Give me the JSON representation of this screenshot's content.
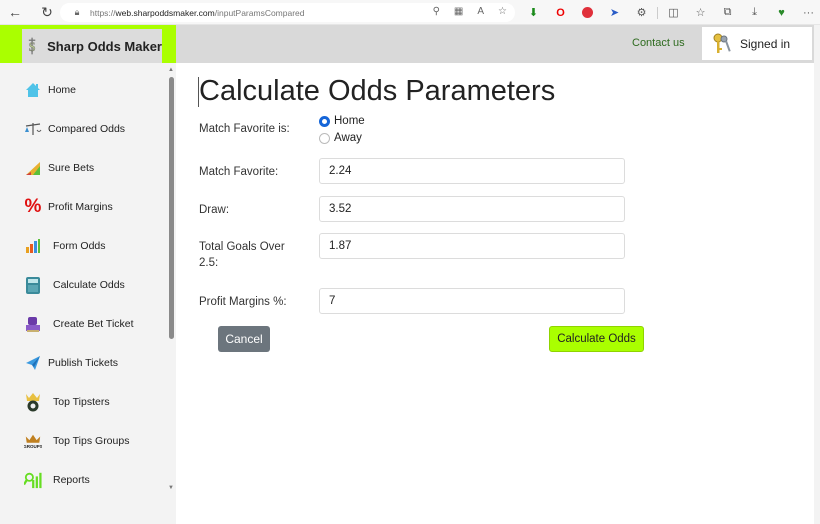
{
  "browser": {
    "url_scheme": "https://",
    "url_host": "web.sharpoddsmaker.com",
    "url_path": "/inputParamsCompared",
    "back_icon": "←",
    "refresh_icon": "↻",
    "more_icon": "···"
  },
  "header": {
    "brand": "Sharp Odds Maker",
    "contact": "Contact us",
    "signed_in": "Signed in",
    "accent_color": "#aaff00"
  },
  "sidebar": {
    "items": [
      {
        "label": "Home",
        "icon": "home-icon"
      },
      {
        "label": "Compared Odds",
        "icon": "scales-icon"
      },
      {
        "label": "Sure Bets",
        "icon": "chart-rising-icon"
      },
      {
        "label": "Profit Margins",
        "icon": "percent-icon"
      },
      {
        "label": "Form Odds",
        "icon": "bar-chart-icon"
      },
      {
        "label": "Calculate Odds",
        "icon": "calculator-icon"
      },
      {
        "label": "Create Bet Ticket",
        "icon": "ticket-printer-icon"
      },
      {
        "label": "Publish Tickets",
        "icon": "paper-plane-icon"
      },
      {
        "label": "Top Tipsters",
        "icon": "crown-ball-icon"
      },
      {
        "label": "Top Tips Groups",
        "icon": "crown-groups-icon"
      },
      {
        "label": "Reports",
        "icon": "reports-icon"
      }
    ]
  },
  "form": {
    "title": "Calculate Odds Parameters",
    "favorite_label": "Match Favorite is:",
    "favorite_options": [
      "Home",
      "Away"
    ],
    "favorite_selected": "Home",
    "fields": [
      {
        "label": "Match Favorite:",
        "value": "2.24"
      },
      {
        "label": "Draw:",
        "value": "3.52"
      },
      {
        "label": "Total Goals Over 2.5:",
        "value": "1.87"
      },
      {
        "label": "Profit Margins %:",
        "value": "7"
      }
    ],
    "cancel": "Cancel",
    "submit": "Calculate Odds"
  }
}
